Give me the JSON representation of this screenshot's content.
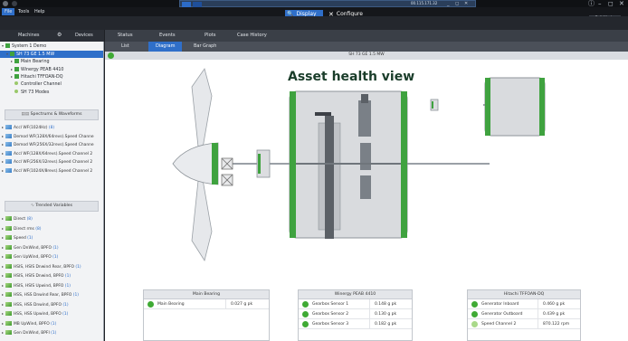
{
  "window": {
    "title": "00.115.171.32"
  },
  "menu": {
    "file": "File",
    "tools": "Tools",
    "help": "Help"
  },
  "modes": {
    "display": "Display",
    "configure": "Configure",
    "full_mode": "Full Mode"
  },
  "sidebar": {
    "tabs": {
      "machines": "Machines",
      "devices": "Devices"
    },
    "tree": [
      {
        "label": "System 1 Demo",
        "depth": 0,
        "icon": "machine-group-icon"
      },
      {
        "label": "SH 73 GE 1.5 MW",
        "depth": 1,
        "icon": "machine-icon",
        "selected": true
      },
      {
        "label": "Main Bearing",
        "depth": 2,
        "icon": "machine-icon"
      },
      {
        "label": "Winergy PEAB 4410",
        "depth": 2,
        "icon": "machine-icon"
      },
      {
        "label": "Hitachi TFFOAN-DQ",
        "depth": 2,
        "icon": "machine-icon"
      },
      {
        "label": "Controller Channel",
        "depth": 2,
        "icon": "channel-icon"
      },
      {
        "label": "SH 73 Modes",
        "depth": 2,
        "icon": "channel-icon"
      }
    ],
    "spectrums_header": "Spectrums & Waveforms",
    "spectrums": [
      {
        "label": "Accl WF(1024Hz)",
        "count": "(8)"
      },
      {
        "label": "Demod WF(128X/64revs).Speed Channe",
        "count": ""
      },
      {
        "label": "Demod WF(256X/32revs).Speed Channe",
        "count": ""
      },
      {
        "label": "Accl WF(128X/64revs).Speed Channel 2",
        "count": ""
      },
      {
        "label": "Accl WF(256X/32revs).Speed Channel 2",
        "count": ""
      },
      {
        "label": "Accl WF(1024X/8revs).Speed Channel 2",
        "count": ""
      }
    ],
    "trended_header": "Trended Variables",
    "trended": [
      {
        "label": "Direct",
        "count": "(8)"
      },
      {
        "label": "Direct rms",
        "count": "(8)"
      },
      {
        "label": "Speed",
        "count": "(1)"
      },
      {
        "label": "Gen DnWind, BPFO",
        "count": "(1)"
      },
      {
        "label": "Gen UpWind, BPFO",
        "count": "(1)"
      },
      {
        "label": "HSIS, HSIS Dnwind Rear, BPFO",
        "count": "(1)"
      },
      {
        "label": "HSIS, HSIS Dnwind, BPFO",
        "count": "(1)"
      },
      {
        "label": "HSIS, HSIS Upwind, BPFO",
        "count": "(1)"
      },
      {
        "label": "HSS, HSS Dnwind Rear, BPFO",
        "count": "(1)"
      },
      {
        "label": "HSS, HSS Dnwind, BPFO",
        "count": "(1)"
      },
      {
        "label": "HSS, HSS Upwind, BPFO",
        "count": "(1)"
      },
      {
        "label": "MB UpWind, BPFO",
        "count": "(1)"
      },
      {
        "label": "Gen DnWind, BPFI",
        "count": "(1)"
      }
    ]
  },
  "main": {
    "tabs": [
      "Status",
      "Events",
      "Plots",
      "Case History"
    ],
    "subtabs": [
      "List",
      "Diagram",
      "Bar Graph"
    ],
    "active_subtab": "Diagram",
    "machine_title": "SH 73 GE 1.5 MW",
    "view_title": "Asset health view"
  },
  "panels": [
    {
      "title": "Main Bearing",
      "rows": [
        {
          "label": "Main Bearing",
          "value": "0.027 g pk",
          "status": "ok"
        }
      ]
    },
    {
      "title": "Winergy PEAB 4410",
      "rows": [
        {
          "label": "Gearbox Sensor 1",
          "value": "0.148 g pk",
          "status": "ok"
        },
        {
          "label": "Gearbox Sensor 2",
          "value": "0.130 g pk",
          "status": "ok"
        },
        {
          "label": "Gearbox Sensor 3",
          "value": "0.182 g pk",
          "status": "ok"
        }
      ]
    },
    {
      "title": "Hitachi TFFOAN-DQ",
      "rows": [
        {
          "label": "Generator Inboard",
          "value": "0.460 g pk",
          "status": "ok"
        },
        {
          "label": "Generator Outboard",
          "value": "0.439 g pk",
          "status": "ok"
        },
        {
          "label": "Speed Channel 2",
          "value": "870.122 rpm",
          "status": "light"
        }
      ]
    }
  ],
  "colors": {
    "status_ok": "#3faa34",
    "status_light": "#a9d98a",
    "accent": "#2f6fc9",
    "title_text": "#1a3d2a",
    "component_fill": "#d9dbde"
  }
}
